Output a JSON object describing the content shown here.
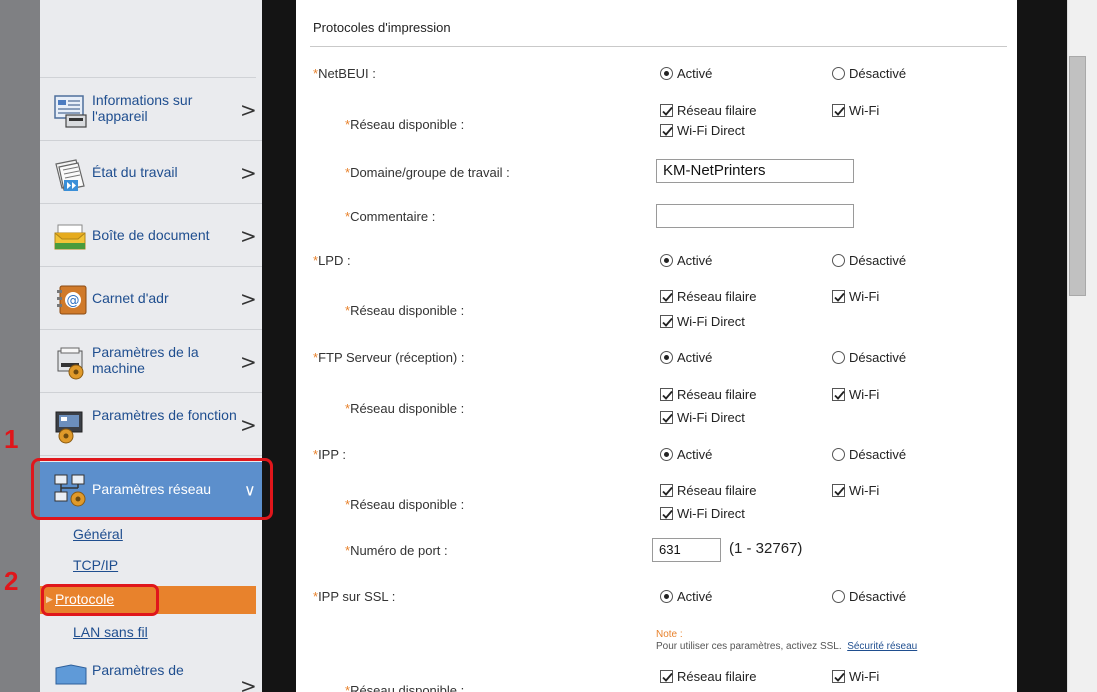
{
  "sidebar": {
    "items": [
      {
        "label": "Informations sur l'appareil"
      },
      {
        "label": "État du travail"
      },
      {
        "label": "Boîte de document"
      },
      {
        "label": "Carnet d'adr"
      },
      {
        "label": "Paramètres de la machine"
      },
      {
        "label": "Paramètres de fonction"
      },
      {
        "label": "Paramètres réseau"
      },
      {
        "label": "Paramètres de"
      }
    ],
    "subitems": [
      {
        "label": "Général"
      },
      {
        "label": "TCP/IP"
      },
      {
        "label": "Protocole"
      },
      {
        "label": "LAN sans fil"
      }
    ],
    "step_numbers": [
      "1",
      "2"
    ],
    "chevron_right": ">",
    "chevron_down": "∨"
  },
  "main": {
    "section_title": "Protocoles d'impression",
    "required_mark": "*",
    "radio_on": "Activé",
    "radio_off": "Désactivé",
    "check_wired": "Réseau filaire",
    "check_wifi": "Wi-Fi",
    "check_wifi_direct": "Wi-Fi Direct",
    "rows": {
      "netbeui": "NetBEUI :",
      "reseau": "Réseau disponible :",
      "domaine": "Domaine/groupe de travail :",
      "domaine_value": "KM-NetPrinters",
      "commentaire": "Commentaire :",
      "commentaire_value": "",
      "lpd": "LPD :",
      "ftp": "FTP Serveur (réception) :",
      "ipp": "IPP :",
      "port": "Numéro de port :",
      "port_value": "631",
      "port_range": "(1 - 32767)",
      "ipp_ssl": "IPP sur SSL :"
    },
    "note": {
      "head": "Note :",
      "text": "Pour utiliser ces paramètres, activez SSL.",
      "link": "Sécurité réseau"
    }
  },
  "colors": {
    "accent_orange": "#e8822c",
    "active_blue": "#5c8fcc",
    "callout_red": "#e0161b",
    "link_blue": "#1f4e8f"
  }
}
